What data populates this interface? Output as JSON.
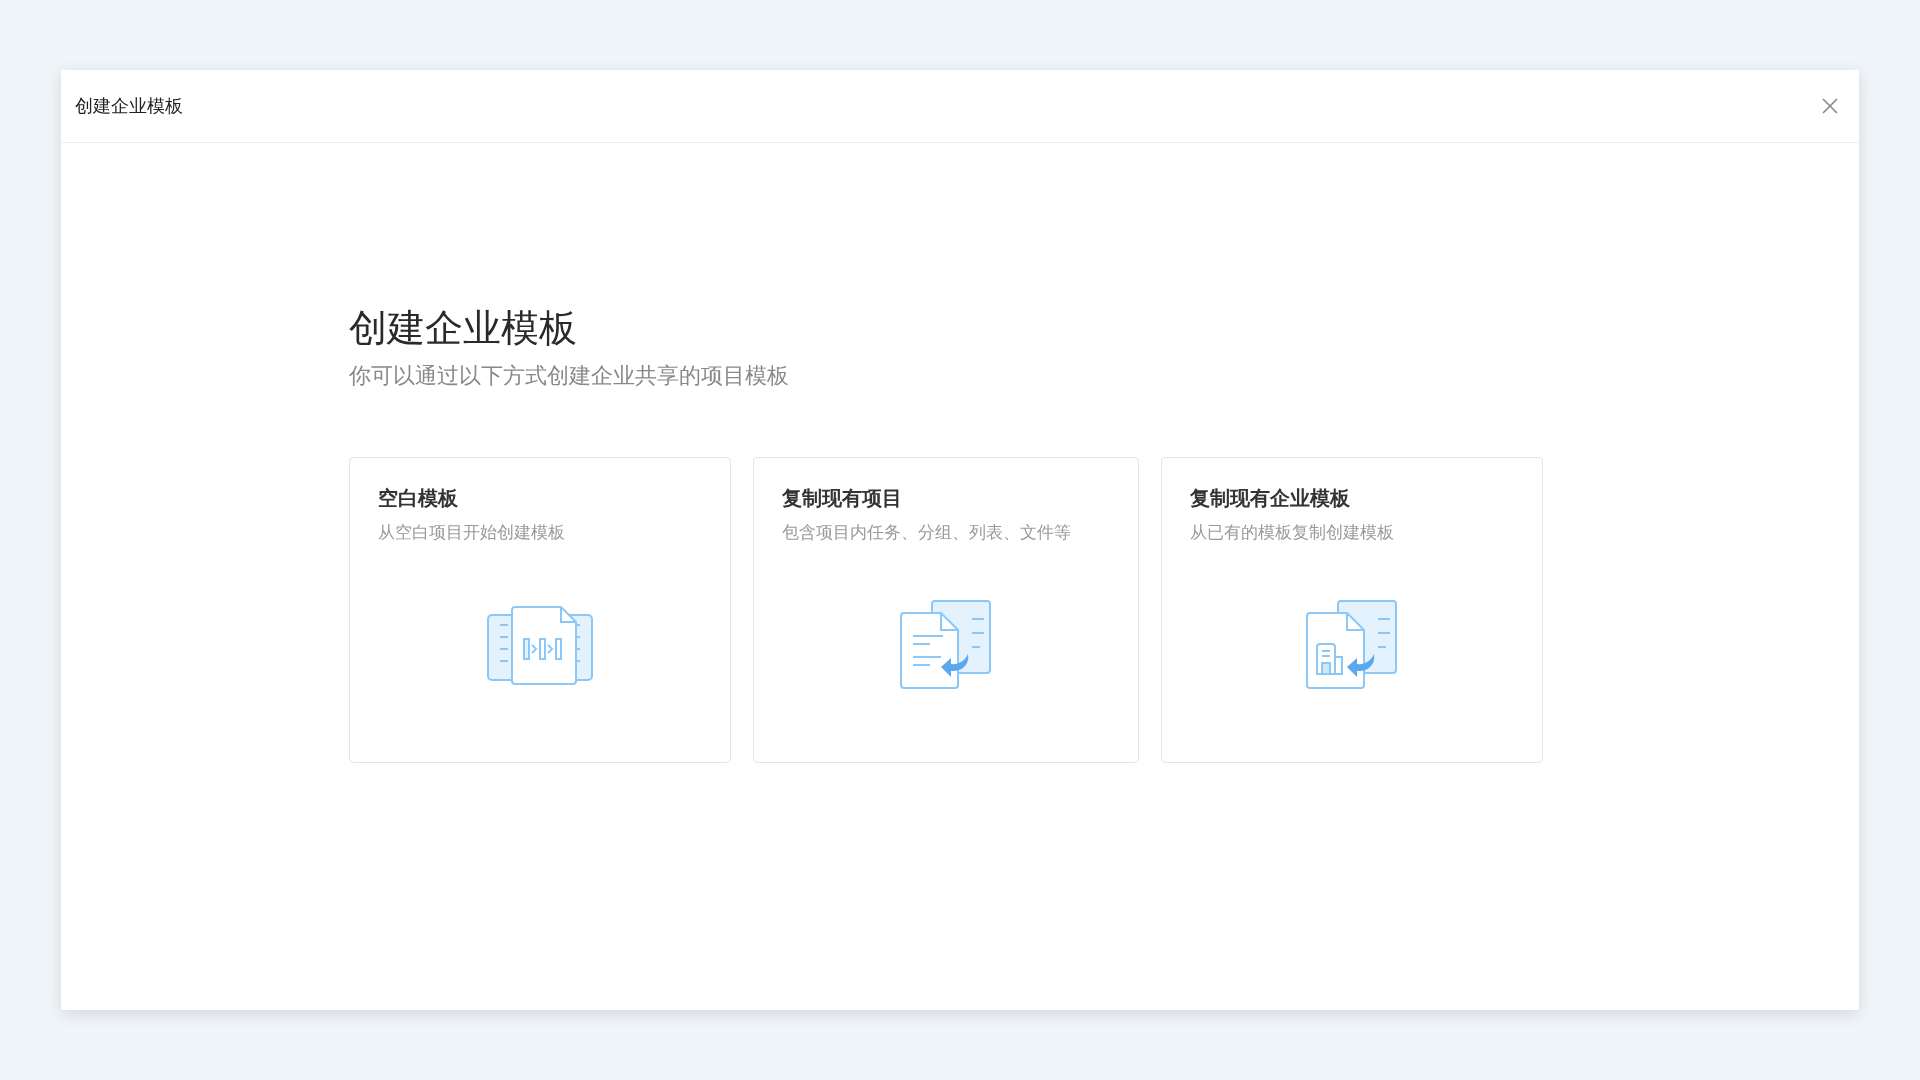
{
  "dialog": {
    "title": "创建企业模板"
  },
  "heading": "创建企业模板",
  "subtitle": "你可以通过以下方式创建企业共享的项目模板",
  "options": [
    {
      "kind": "blank",
      "title": "空白模板",
      "description": "从空白项目开始创建模板"
    },
    {
      "kind": "project",
      "title": "复制现有项目",
      "description": "包含项目内任务、分组、列表、文件等"
    },
    {
      "kind": "template",
      "title": "复制现有企业模板",
      "description": "从已有的模板复制创建模板"
    }
  ]
}
